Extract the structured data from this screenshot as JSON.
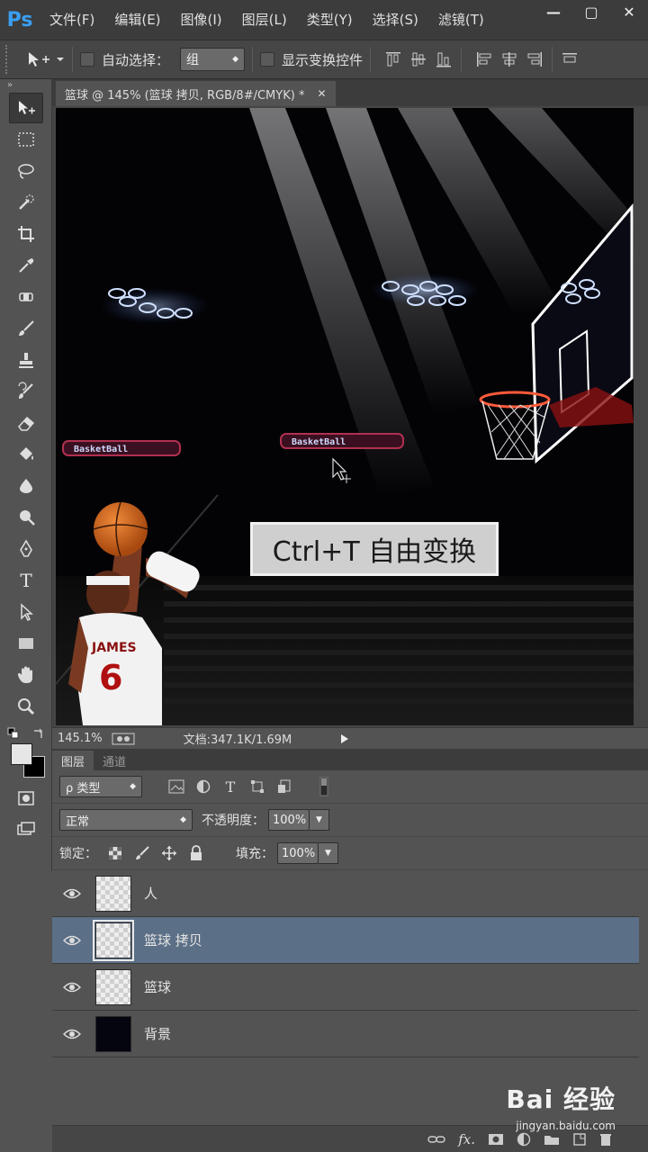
{
  "app": {
    "logo": "Ps"
  },
  "menu": [
    "文件(F)",
    "编辑(E)",
    "图像(I)",
    "图层(L)",
    "类型(Y)",
    "选择(S)",
    "滤镜(T)"
  ],
  "window_controls": [
    "—",
    "▢",
    "✕"
  ],
  "options": {
    "auto_select_label": "自动选择：",
    "auto_select_value": "组",
    "show_transform_label": "显示变换控件"
  },
  "toolbox": {
    "collapse": "»",
    "type_tool": "T"
  },
  "document": {
    "tab_title": "篮球 @ 145% (篮球 拷贝, RGB/8#/CMYK) *",
    "close": "✕",
    "callout": "Ctrl+T 自由变换",
    "jersey_name": "JAMES",
    "jersey_number": "6",
    "banner_text": "BasketBall"
  },
  "status": {
    "zoom": "145.1%",
    "doc_label": "文档:347.1K/1.69M"
  },
  "layers_panel": {
    "tabs": [
      "图层",
      "通道"
    ],
    "filter_label": "ρ 类型",
    "blend_mode": "正常",
    "opacity_label": "不透明度：",
    "opacity_value": "100%",
    "lock_label": "锁定：",
    "fill_label": "填充：",
    "fill_value": "100%",
    "layers": [
      {
        "name": "人",
        "selected": false,
        "thumb": "transparent"
      },
      {
        "name": "篮球 拷贝",
        "selected": true,
        "thumb": "transparent"
      },
      {
        "name": "篮球",
        "selected": false,
        "thumb": "transparent"
      },
      {
        "name": "背景",
        "selected": false,
        "thumb": "dark"
      }
    ]
  },
  "watermark": {
    "brand": "Bai 经验",
    "url": "jingyan.baidu.com"
  }
}
